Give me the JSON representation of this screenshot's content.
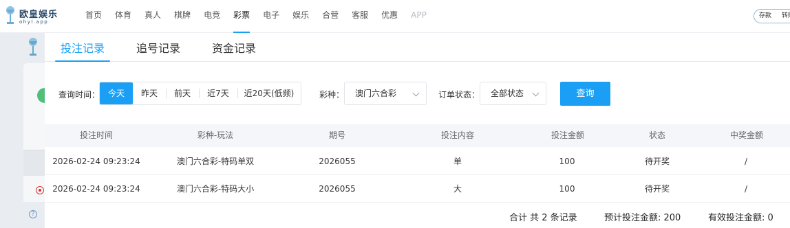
{
  "brand": {
    "name": "欧皇娱乐",
    "domain": "ohyl.app"
  },
  "nav": {
    "items": [
      "首页",
      "体育",
      "真人",
      "棋牌",
      "电竞",
      "彩票",
      "电子",
      "娱乐",
      "合营",
      "客服",
      "优惠",
      "APP"
    ],
    "active": "彩票"
  },
  "topright": {
    "deposit": "存款",
    "transfer": "转账"
  },
  "tabs": [
    "投注记录",
    "追号记录",
    "资金记录"
  ],
  "filters": {
    "time_label": "查询时间：",
    "time_options": [
      "今天",
      "昨天",
      "前天",
      "近7天",
      "近20天(低频)"
    ],
    "time_selected": "今天",
    "lottery_label": "彩种：",
    "lottery_value": "澳门六合彩",
    "status_label": "订单状态：",
    "status_value": "全部状态",
    "query_button": "查询"
  },
  "table": {
    "columns": [
      "投注时间",
      "彩种-玩法",
      "期号",
      "投注内容",
      "投注金额",
      "状态",
      "中奖金额"
    ],
    "rows": [
      [
        "2026-02-24 09:23:24",
        "澳门六合彩-特码单双",
        "2026055",
        "单",
        "100",
        "待开奖",
        "/"
      ],
      [
        "2026-02-24 09:23:24",
        "澳门六合彩-特码大小",
        "2026055",
        "大",
        "100",
        "待开奖",
        "/"
      ]
    ]
  },
  "summary": {
    "total_records": "合计 共 2 条记录",
    "estimated_bet": "预计投注金额: 200",
    "valid_bet": "有效投注金额: 0"
  },
  "colors": {
    "accent": "#1a9ff5",
    "header_bg": "#f4f6f9"
  }
}
